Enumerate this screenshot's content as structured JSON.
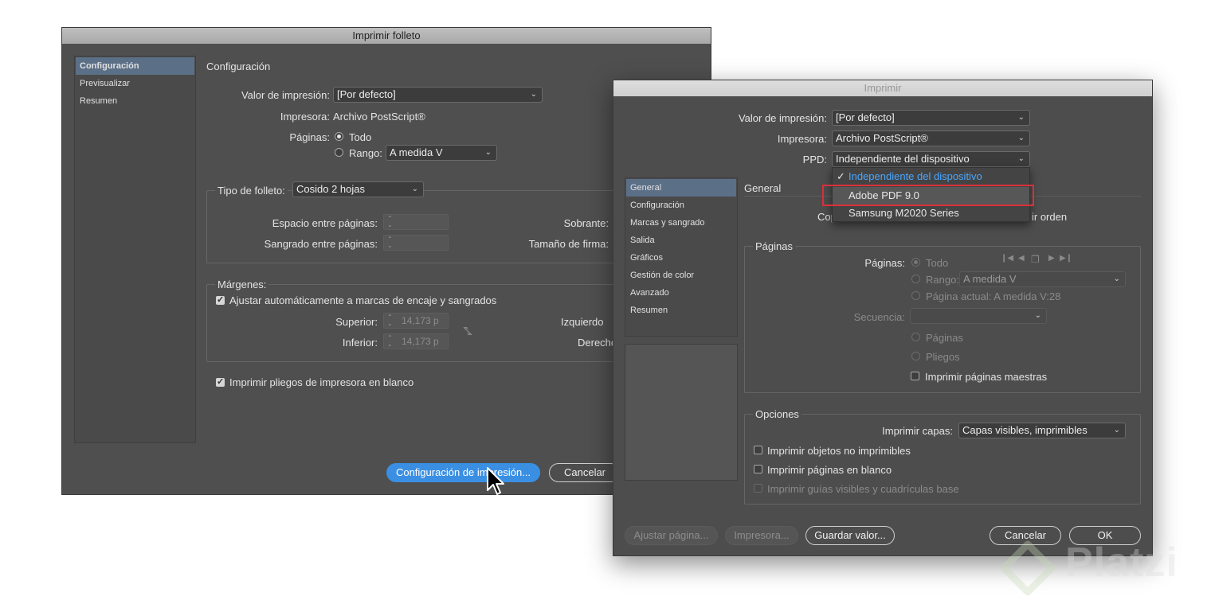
{
  "booklet": {
    "title": "Imprimir folleto",
    "sidebar": [
      "Configuración",
      "Previsualizar",
      "Resumen"
    ],
    "section_title": "Configuración",
    "print_preset_label": "Valor de impresión:",
    "print_preset_value": "[Por defecto]",
    "printer_label": "Impresora:",
    "printer_value": "Archivo PostScript®",
    "pages_label": "Páginas:",
    "pages_all": "Todo",
    "pages_range_label": "Rango:",
    "pages_range_value": "A medida V",
    "booklet_type_label": "Tipo de folleto:",
    "booklet_type_value": "Cosido 2 hojas",
    "space_between_label": "Espacio entre páginas:",
    "bleed_between_label": "Sangrado entre páginas:",
    "creep_label": "Sobrante:",
    "signature_size_label": "Tamaño de firma:",
    "margins_label": "Márgenes:",
    "auto_adjust_label": "Ajustar automáticamente a marcas de encaje y sangrados",
    "top_label": "Superior:",
    "top_value": "14,173 p",
    "bottom_label": "Inferior:",
    "bottom_value": "14,173 p",
    "left_label": "Izquierdo",
    "right_label": "Derecho",
    "blank_spreads_label": "Imprimir pliegos de impresora en blanco",
    "print_settings_button": "Configuración de impresión...",
    "cancel_button": "Cancelar"
  },
  "print": {
    "title": "Imprimir",
    "print_preset_label": "Valor de impresión:",
    "print_preset_value": "[Por defecto]",
    "printer_label": "Impresora:",
    "printer_value": "Archivo PostScript®",
    "ppd_label": "PPD:",
    "ppd_value": "Independiente del dispositivo",
    "ppd_options": [
      "Independiente del dispositivo",
      "Adobe PDF 9.0",
      "Samsung M2020 Series"
    ],
    "sidebar": [
      "General",
      "Configuración",
      "Marcas y sangrado",
      "Salida",
      "Gráficos",
      "Gestión de color",
      "Avanzado",
      "Resumen"
    ],
    "section_title": "General",
    "copies_partial": "Cop",
    "reverse_partial": "ir orden",
    "pages_group": "Páginas",
    "pages_label": "Páginas:",
    "pages_all": "Todo",
    "pages_range_label": "Rango:",
    "pages_range_value": "A medida V",
    "current_page": "Página actual: A medida V:28",
    "sequence_label": "Secuencia:",
    "pages_option": "Páginas",
    "spreads_option": "Pliegos",
    "master_pages_label": "Imprimir páginas maestras",
    "options_group": "Opciones",
    "print_layers_label": "Imprimir capas:",
    "print_layers_value": "Capas visibles, imprimibles",
    "nonprinting_label": "Imprimir objetos no imprimibles",
    "blank_pages_label": "Imprimir páginas en blanco",
    "guides_label": "Imprimir guías visibles y cuadrículas base",
    "page_setup_button": "Ajustar página...",
    "printer_button": "Impresora...",
    "save_preset_button": "Guardar valor...",
    "cancel_button": "Cancelar",
    "ok_button": "OK"
  },
  "watermark": "Platzi"
}
